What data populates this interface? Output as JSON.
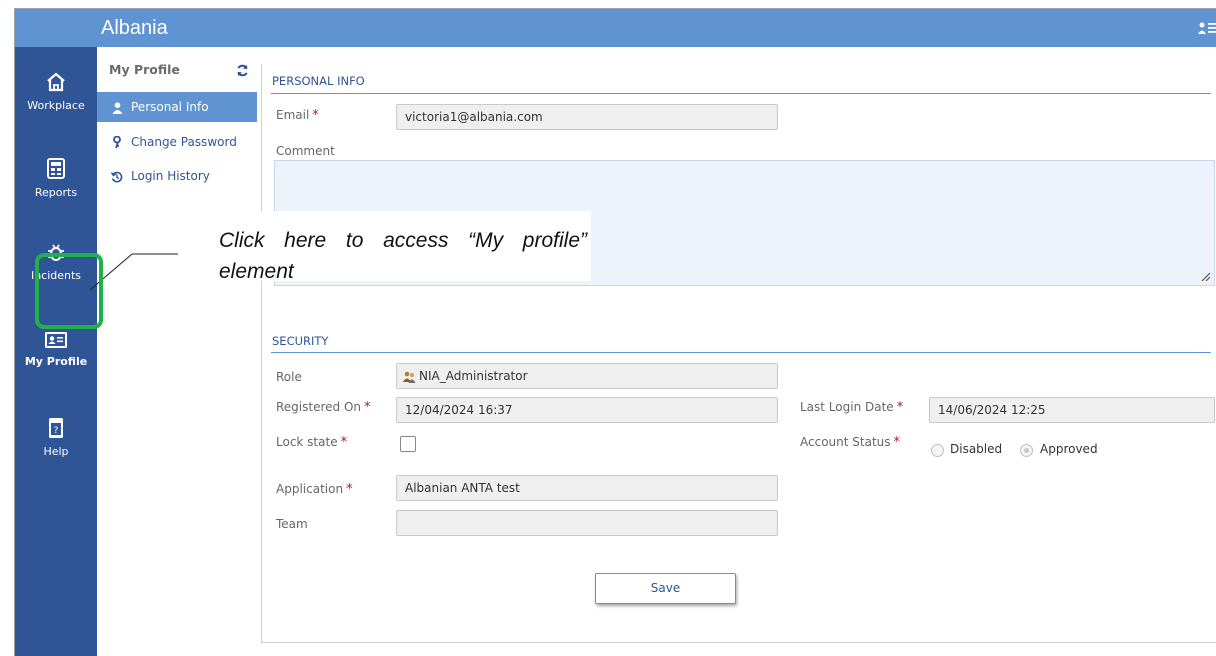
{
  "app": {
    "title": "Albania"
  },
  "nav": {
    "items": [
      {
        "label": "Workplace",
        "icon": "home-icon"
      },
      {
        "label": "Reports",
        "icon": "report-icon"
      },
      {
        "label": "Incidents",
        "icon": "bug-icon"
      },
      {
        "label": "My Profile",
        "icon": "id-card-icon",
        "active": true
      },
      {
        "label": "Help",
        "icon": "help-book-icon"
      }
    ]
  },
  "submenu": {
    "title": "My Profile",
    "items": [
      {
        "label": "Personal Info",
        "icon": "person-icon",
        "active": true
      },
      {
        "label": "Change Password",
        "icon": "key-icon"
      },
      {
        "label": "Login History",
        "icon": "history-icon"
      }
    ]
  },
  "personal_info": {
    "section_title": "PERSONAL INFO",
    "email_label": "Email",
    "email_value": "victoria1@albania.com",
    "comment_label": "Comment",
    "comment_value": ""
  },
  "security": {
    "section_title": "SECURITY",
    "role_label": "Role",
    "role_value": "NIA_Administrator",
    "registered_label": "Registered On",
    "registered_value": "12/04/2024 16:37",
    "last_login_label": "Last Login Date",
    "last_login_value": "14/06/2024 12:25",
    "lock_label": "Lock state",
    "lock_checked": false,
    "account_status_label": "Account Status",
    "status_options": [
      "Disabled",
      "Approved"
    ],
    "status_selected": "Approved",
    "application_label": "Application",
    "application_value": "Albanian ANTA test",
    "team_label": "Team",
    "team_value": ""
  },
  "actions": {
    "save_label": "Save"
  },
  "callout": {
    "text": "Click here to access “My profile” element"
  },
  "colors": {
    "topbar": "#5f93d2",
    "nav": "#2f5597",
    "highlight": "#22b04a",
    "required": "#b01818"
  }
}
